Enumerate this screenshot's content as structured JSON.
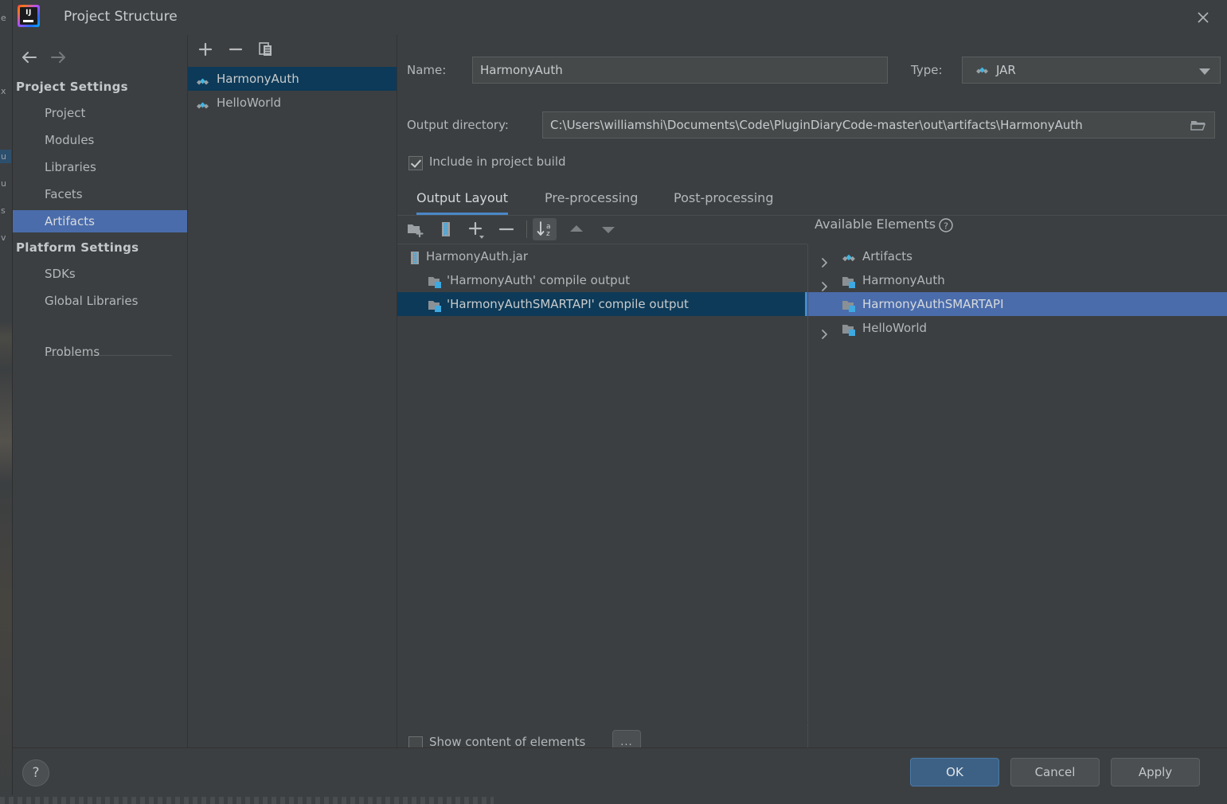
{
  "window": {
    "title": "Project Structure",
    "logo_icon": "intellij-idea-logo",
    "close_icon": "close-icon"
  },
  "sidebar": {
    "nav": {
      "back_icon": "arrow-left-icon",
      "forward_icon": "arrow-right-icon"
    },
    "groups": [
      {
        "label": "Project Settings",
        "items": [
          {
            "label": "Project",
            "selected": false
          },
          {
            "label": "Modules",
            "selected": false
          },
          {
            "label": "Libraries",
            "selected": false
          },
          {
            "label": "Facets",
            "selected": false
          },
          {
            "label": "Artifacts",
            "selected": true
          }
        ]
      },
      {
        "label": "Platform Settings",
        "items": [
          {
            "label": "SDKs",
            "selected": false
          },
          {
            "label": "Global Libraries",
            "selected": false
          }
        ]
      }
    ],
    "extra_items": [
      {
        "label": "Problems",
        "selected": false
      }
    ],
    "selection_color": "#4a6cab"
  },
  "artifacts_panel": {
    "toolbar": {
      "add_icon": "plus-icon",
      "remove_icon": "minus-icon",
      "copy_icon": "copy-icon"
    },
    "items": [
      {
        "label": "HarmonyAuth",
        "icon": "artifact-diamond-icon",
        "selected": true
      },
      {
        "label": "HelloWorld",
        "icon": "artifact-diamond-icon",
        "selected": false
      }
    ],
    "selection_color": "#0d3a58"
  },
  "details": {
    "name_label": "Name:",
    "name_value": "HarmonyAuth",
    "type_label": "Type:",
    "type_value": "JAR",
    "type_icon": "artifact-diamond-icon",
    "type_chevron_icon": "chevron-down-icon",
    "output_dir_label": "Output directory:",
    "output_dir_value": "C:\\Users\\williamshi\\Documents\\Code\\PluginDiaryCode-master\\out\\artifacts\\HarmonyAuth",
    "browse_icon": "folder-browse-icon",
    "include_in_build_label": "Include in project build",
    "include_in_build_checked": true
  },
  "tabs": [
    {
      "label": "Output Layout",
      "active": true
    },
    {
      "label": "Pre-processing",
      "active": false
    },
    {
      "label": "Post-processing",
      "active": false
    }
  ],
  "layout_toolbar": [
    {
      "name": "add-directory-icon",
      "toggled": false
    },
    {
      "name": "add-archive-icon",
      "toggled": false
    },
    {
      "name": "add-element-dropdown-icon",
      "toggled": false
    },
    {
      "name": "remove-element-icon",
      "toggled": false
    },
    {
      "name": "sort-alphabetically-icon",
      "toggled": true
    },
    {
      "name": "move-up-icon",
      "toggled": false
    },
    {
      "name": "move-down-icon",
      "toggled": false
    }
  ],
  "output_tree": [
    {
      "label": "HarmonyAuth.jar",
      "icon": "jar-archive-icon",
      "depth": 0,
      "selected": false
    },
    {
      "label": "'HarmonyAuth' compile output",
      "icon": "compile-output-folder-icon",
      "depth": 1,
      "selected": false
    },
    {
      "label": "'HarmonyAuthSMARTAPI' compile output",
      "icon": "compile-output-folder-icon",
      "depth": 1,
      "selected": true
    }
  ],
  "available_elements": {
    "header": "Available Elements",
    "help_icon": "help-circle-icon",
    "items": [
      {
        "label": "Artifacts",
        "icon": "artifact-diamond-icon",
        "expandable": true,
        "selected": false
      },
      {
        "label": "HarmonyAuth",
        "icon": "module-folder-icon",
        "expandable": true,
        "selected": false
      },
      {
        "label": "HarmonyAuthSMARTAPI",
        "icon": "module-folder-icon",
        "expandable": false,
        "selected": true
      },
      {
        "label": "HelloWorld",
        "icon": "module-folder-icon",
        "expandable": true,
        "selected": false
      }
    ],
    "selection_color": "#4a6cab"
  },
  "bottom": {
    "show_content_label": "Show content of elements",
    "show_content_checked": false,
    "ellipsis_label": "..."
  },
  "footer": {
    "help_label": "?",
    "ok_label": "OK",
    "cancel_label": "Cancel",
    "apply_label": "Apply",
    "primary_color": "#3d6185"
  }
}
